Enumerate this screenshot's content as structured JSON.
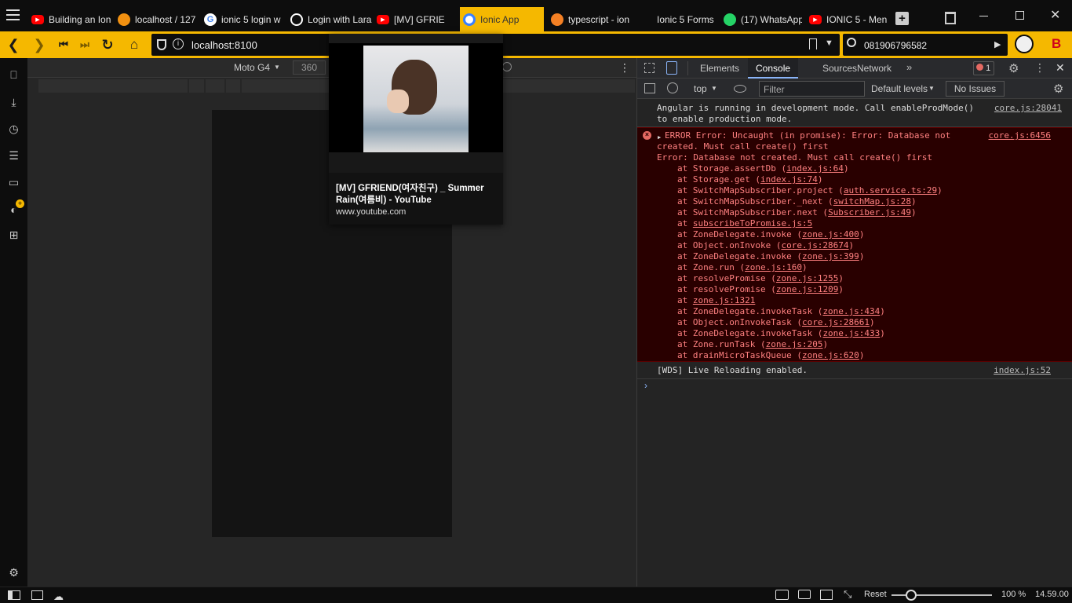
{
  "tabs": [
    {
      "label": "Building an Ion",
      "icon": "youtube-icon",
      "color": "#ff0000"
    },
    {
      "label": "localhost / 127",
      "icon": "phpmyadmin-icon",
      "color": "#f29111"
    },
    {
      "label": "ionic 5 login w",
      "icon": "google-icon",
      "color": "#4285f4"
    },
    {
      "label": "Login with Lara",
      "icon": "github-icon",
      "color": "#ffffff"
    },
    {
      "label": "[MV] GFRIE",
      "icon": "youtube-icon",
      "color": "#ff0000"
    },
    {
      "label": "Ionic App",
      "icon": "ionic-icon",
      "color": "#3880ff"
    },
    {
      "label": "typescript - ion",
      "icon": "stackoverflow-icon",
      "color": "#f48024"
    },
    {
      "label": "Ionic 5 Forms",
      "icon": "blank-icon",
      "color": "#333333"
    },
    {
      "label": "(17) WhatsApp",
      "icon": "whatsapp-icon",
      "color": "#25d366"
    },
    {
      "label": "IONIC 5 - Men",
      "icon": "youtube-icon",
      "color": "#ff0000"
    }
  ],
  "addressbar": {
    "url": "localhost:8100",
    "search_value": "081906796582"
  },
  "device_toolbar": {
    "device": "Moto G4",
    "width": "360"
  },
  "preview": {
    "title": "[MV] GFRIEND(여자친구) _ Summer Rain(여름비) - YouTube",
    "domain": "www.youtube.com"
  },
  "devtools": {
    "tabs": [
      "Elements",
      "Console",
      "Sources",
      "Network"
    ],
    "error_count": "1",
    "context": "top",
    "filter_placeholder": "Filter",
    "levels": "Default levels",
    "issues": "No Issues",
    "console": {
      "angular_msg_1": "Angular is running in development mode. Call enableProdMode()",
      "angular_msg_2": "to enable production mode.",
      "angular_src": "core.js:28041",
      "error_line_1": "ERROR Error: Uncaught (in promise): Error: Database not",
      "error_line_2": "created. Must call create() first",
      "error_line_3": "Error: Database not created. Must call create() first",
      "error_src": "core.js:6456",
      "stack": [
        {
          "fn": "at Storage.assertDb (",
          "file": "index.js:64",
          "end": ")"
        },
        {
          "fn": "at Storage.get (",
          "file": "index.js:74",
          "end": ")"
        },
        {
          "fn": "at SwitchMapSubscriber.project (",
          "file": "auth.service.ts:29",
          "end": ")"
        },
        {
          "fn": "at SwitchMapSubscriber._next (",
          "file": "switchMap.js:28",
          "end": ")"
        },
        {
          "fn": "at SwitchMapSubscriber.next (",
          "file": "Subscriber.js:49",
          "end": ")"
        },
        {
          "fn": "at ",
          "file": "subscribeToPromise.js:5",
          "end": ""
        },
        {
          "fn": "at ZoneDelegate.invoke (",
          "file": "zone.js:400",
          "end": ")"
        },
        {
          "fn": "at Object.onInvoke (",
          "file": "core.js:28674",
          "end": ")"
        },
        {
          "fn": "at ZoneDelegate.invoke (",
          "file": "zone.js:399",
          "end": ")"
        },
        {
          "fn": "at Zone.run (",
          "file": "zone.js:160",
          "end": ")"
        },
        {
          "fn": "at resolvePromise (",
          "file": "zone.js:1255",
          "end": ")"
        },
        {
          "fn": "at resolvePromise (",
          "file": "zone.js:1209",
          "end": ")"
        },
        {
          "fn": "at ",
          "file": "zone.js:1321",
          "end": ""
        },
        {
          "fn": "at ZoneDelegate.invokeTask (",
          "file": "zone.js:434",
          "end": ")"
        },
        {
          "fn": "at Object.onInvokeTask (",
          "file": "core.js:28661",
          "end": ")"
        },
        {
          "fn": "at ZoneDelegate.invokeTask (",
          "file": "zone.js:433",
          "end": ")"
        },
        {
          "fn": "at Zone.runTask (",
          "file": "zone.js:205",
          "end": ")"
        },
        {
          "fn": "at drainMicroTaskQueue (",
          "file": "zone.js:620",
          "end": ")"
        }
      ],
      "wds_msg": "[WDS] Live Reloading enabled.",
      "wds_src": "index.js:52"
    }
  },
  "statusbar": {
    "reset": "Reset",
    "zoom": "100 %",
    "time": "14.59.00",
    "zoom_level": 0.05
  }
}
